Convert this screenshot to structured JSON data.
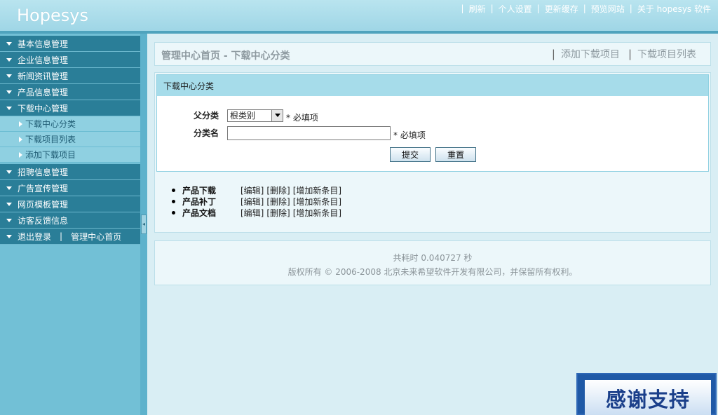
{
  "header": {
    "logo": "Hopesys",
    "nav": [
      "刷新",
      "个人设置",
      "更新缓存",
      "预览网站",
      "关于 hopesys 软件"
    ]
  },
  "sidebar": {
    "groups": [
      {
        "label": "基本信息管理"
      },
      {
        "label": "企业信息管理"
      },
      {
        "label": "新闻资讯管理"
      },
      {
        "label": "产品信息管理"
      },
      {
        "label": "下载中心管理"
      }
    ],
    "subitems": [
      "下载中心分类",
      "下载项目列表",
      "添加下载项目"
    ],
    "groups_after": [
      {
        "label": "招聘信息管理"
      },
      {
        "label": "广告宣传管理"
      },
      {
        "label": "网页模板管理"
      },
      {
        "label": "访客反馈信息"
      }
    ],
    "logout": "退出登录",
    "logout_sep": "|",
    "home": "管理中心首页"
  },
  "title_bar": {
    "breadcrumb": "管理中心首页  - 下载中心分类",
    "actions": [
      "添加下载项目",
      "下载项目列表"
    ]
  },
  "panel": {
    "title": "下载中心分类",
    "parent_label": "父分类",
    "parent_value": "根类别",
    "required": "* 必填项",
    "name_label": "分类名",
    "name_value": "",
    "submit": "提交",
    "reset": "重置"
  },
  "categories": [
    {
      "name": "产品下载",
      "edit": "[编辑]",
      "delete": "[删除]",
      "add": "[增加新条目]"
    },
    {
      "name": "产品补丁",
      "edit": "[编辑]",
      "delete": "[删除]",
      "add": "[增加新条目]"
    },
    {
      "name": "产品文档",
      "edit": "[编辑]",
      "delete": "[删除]",
      "add": "[增加新条目]"
    }
  ],
  "footer": {
    "timing": "共耗时 0.040727 秒",
    "copyright": "版权所有 © 2006-2008 北京未来希望软件开发有限公司，并保留所有权利。"
  },
  "banner": {
    "text": "感谢支持"
  },
  "colors": {
    "header": "#9fd6e6",
    "menu_group": "#2a7e98",
    "menu_sub": "#8fd0e1",
    "panel_head": "#a6dcea"
  }
}
